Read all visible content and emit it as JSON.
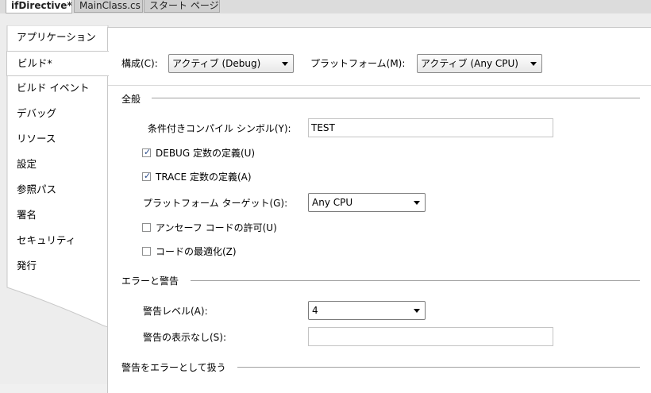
{
  "doc_tabs": [
    {
      "label": "ifDirective*",
      "active": true
    },
    {
      "label": "MainClass.cs",
      "active": false
    },
    {
      "label": "スタート ページ",
      "active": false
    }
  ],
  "sidebar": {
    "items": [
      {
        "label": "アプリケーション"
      },
      {
        "label": "ビルド*",
        "selected": true
      },
      {
        "label": "ビルド イベント"
      },
      {
        "label": "デバッグ"
      },
      {
        "label": "リソース"
      },
      {
        "label": "設定"
      },
      {
        "label": "参照パス"
      },
      {
        "label": "署名"
      },
      {
        "label": "セキュリティ"
      },
      {
        "label": "発行"
      }
    ]
  },
  "config_bar": {
    "config_label": "構成(C):",
    "config_value": "アクティブ (Debug)",
    "platform_label": "プラットフォーム(M):",
    "platform_value": "アクティブ (Any CPU)"
  },
  "general": {
    "header": "全般",
    "symbols_label": "条件付きコンパイル シンボル(Y):",
    "symbols_value": "TEST",
    "debug_const_label": "DEBUG 定数の定義(U)",
    "debug_const_checked": true,
    "trace_const_label": "TRACE 定数の定義(A)",
    "trace_const_checked": true,
    "platform_target_label": "プラットフォーム ターゲット(G):",
    "platform_target_value": "Any CPU",
    "unsafe_label": "アンセーフ コードの許可(U)",
    "unsafe_checked": false,
    "optimize_label": "コードの最適化(Z)",
    "optimize_checked": false
  },
  "errors": {
    "header": "エラーと警告",
    "warning_level_label": "警告レベル(A):",
    "warning_level_value": "4",
    "suppress_label": "警告の表示なし(S):",
    "suppress_value": ""
  },
  "treat_warnings": {
    "header": "警告をエラーとして扱う"
  },
  "colors": {
    "window_bg": "#f0f0f0",
    "content_bg": "#ffffff",
    "check_mark": "#2a4b8a"
  }
}
